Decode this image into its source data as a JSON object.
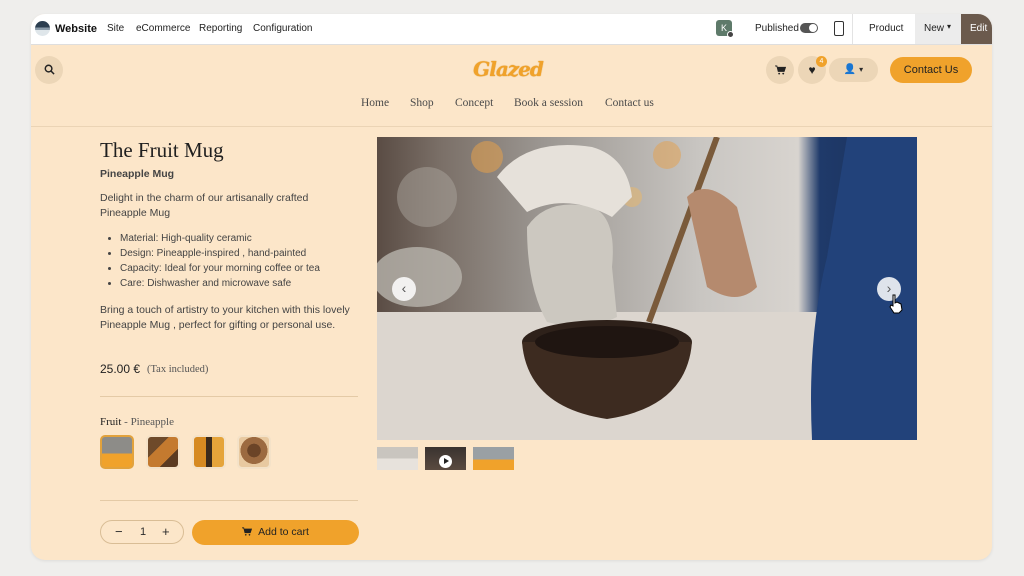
{
  "admin_bar": {
    "app_name": "Website",
    "menu": [
      "Site",
      "eCommerce",
      "Reporting",
      "Configuration"
    ],
    "avatar_initial": "K",
    "published_label": "Published",
    "product_label": "Product",
    "new_label": "New",
    "edit_label": "Edit"
  },
  "site": {
    "logo_text": "Glazed",
    "wishlist_count": "4",
    "contact_label": "Contact Us",
    "nav": [
      "Home",
      "Shop",
      "Concept",
      "Book a session",
      "Contact us"
    ]
  },
  "product": {
    "title": "The Fruit Mug",
    "subtitle": "Pineapple Mug",
    "description": "Delight in the charm of our artisanally crafted Pineapple Mug",
    "features": [
      "Material: High-quality ceramic",
      "Design:  Pineapple-inspired  , hand-painted",
      "Capacity: Ideal for your morning coffee or tea",
      "Care: Dishwasher and microwave safe"
    ],
    "description_2": "Bring a touch of artistry to your kitchen with this lovely  Pineapple Mug  , perfect for gifting or personal use.",
    "price": "25.00 €",
    "tax_note": "(Tax included)",
    "variant_label": "Fruit",
    "variant_value": " - Pineapple",
    "quantity": "1",
    "add_to_cart_label": "Add to cart"
  },
  "colors": {
    "accent": "#f0a22b",
    "page_bg": "#fce6c9",
    "edit_button": "#6b5a4d"
  }
}
